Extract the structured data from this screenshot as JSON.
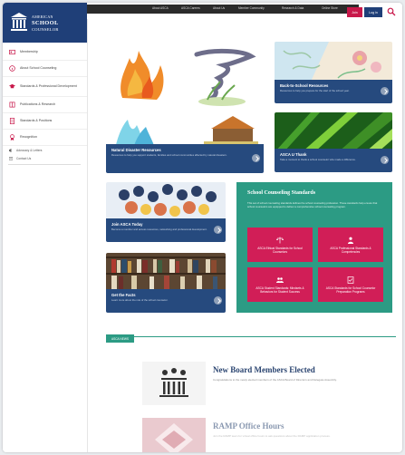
{
  "brand": {
    "line1": "AMERICAN",
    "line2": "SCHOOL",
    "line3": "COUNSELOR",
    "color": "#1f3f78"
  },
  "sidebar": {
    "items": [
      {
        "label": "Membership",
        "icon": "id-card-icon"
      },
      {
        "label": "About School Counseling",
        "icon": "info-icon"
      },
      {
        "label": "Standards & Professional Development",
        "icon": "graduation-icon"
      },
      {
        "label": "Publications & Research",
        "icon": "book-icon"
      },
      {
        "label": "Standards & Positions",
        "icon": "document-icon"
      },
      {
        "label": "Recognition",
        "icon": "award-icon"
      }
    ],
    "sub_items": [
      {
        "label": "Advocacy & Letters",
        "icon": "megaphone-icon"
      },
      {
        "label": "Contact Us",
        "icon": "mail-icon"
      }
    ]
  },
  "topbar": {
    "links": [
      "About ASCA",
      "ASCA Careers",
      "About Us",
      "Member Community",
      "Research & Data",
      "Online Store"
    ],
    "join_label": "Join",
    "login_label": "Log in",
    "accent": "#c8184a"
  },
  "cards": {
    "disaster": {
      "title": "Natural Disaster Resources",
      "desc": "Resources to help you support students, families and school communities affected by natural disasters."
    },
    "back_to_school": {
      "title": "Back-to-School Resources",
      "desc": "Resources to help you prepare for the start of the school year."
    },
    "u_thank": {
      "title": "ASCA U Thank",
      "desc": "Take a moment to thank a school counselor who made a difference."
    },
    "join_asca": {
      "title": "Join ASCA Today",
      "desc": "Become a member and access resources, networking and professional development."
    },
    "get_facts": {
      "title": "Get the Facts",
      "desc": "Learn more about the role of the school counselor."
    }
  },
  "standards": {
    "heading": "School Counseling Standards",
    "body": "This set of school counseling standards defines the school counseling profession. These standards help ensure that school counselors are equipped to deliver a comprehensive school counseling program.",
    "boxes": [
      "ASCA Ethical Standards for School Counselors",
      "ASCA Professional Standards & Competencies",
      "ASCA Student Standards: Mindsets & Behaviors for Student Success",
      "ASCA Standards for School Counselor Preparation Programs"
    ],
    "panel_color": "#2c9b84",
    "box_color": "#d11e57"
  },
  "news": {
    "tag": "ASCA NEWS",
    "items": [
      {
        "title": "New Board Members Elected",
        "desc": "Congratulations to the newly elected members of the ASCA Board of Directors and Delegate Assembly."
      },
      {
        "title": "RAMP Office Hours",
        "desc": "Join the RAMP team for virtual office hours to ask questions about the RAMP application process."
      }
    ]
  }
}
